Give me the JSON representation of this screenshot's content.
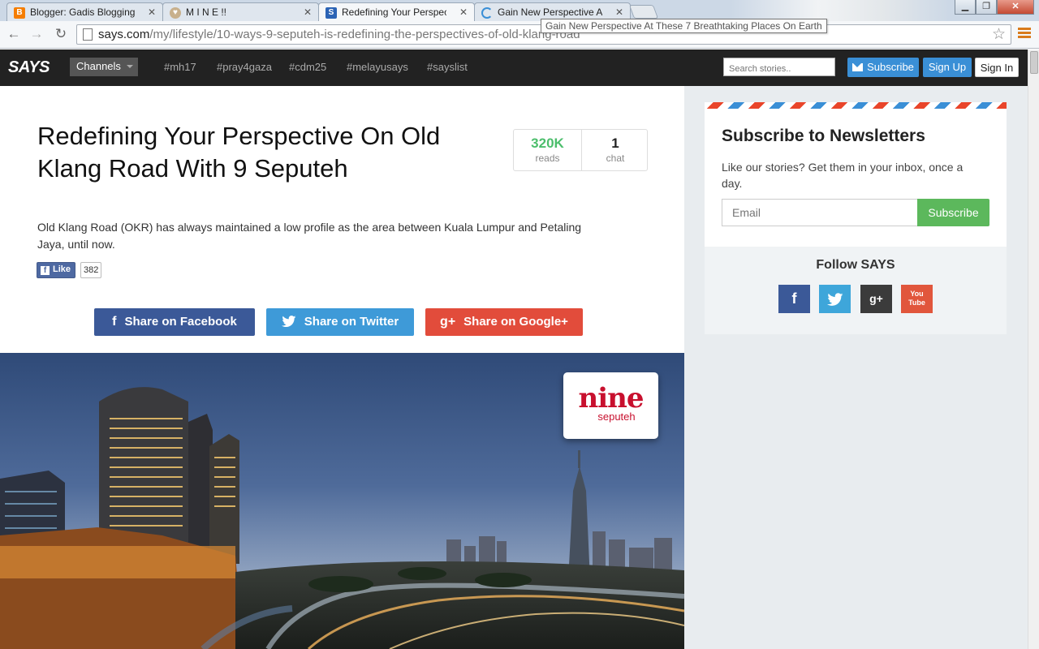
{
  "browser": {
    "tabs": [
      {
        "label": "Blogger: Gadis Blogging Ge",
        "favicon": "blogger-icon",
        "color": "#f57d00"
      },
      {
        "label": "M I N E !!",
        "favicon": "heart-icon",
        "color": "#c8b08c"
      },
      {
        "label": "Redefining Your Perspective",
        "favicon": "says-icon",
        "color": "#2b63b5"
      },
      {
        "label": "Gain New Perspective At T",
        "favicon": "loading-icon",
        "color": "#3a8fd6"
      }
    ],
    "url_host": "says.com",
    "url_path": "/my/lifestyle/10-ways-9-seputeh-is-redefining-the-perspectives-of-old-klang-road",
    "tooltip": "Gain New Perspective At These 7 Breathtaking Places On Earth"
  },
  "nav": {
    "logo": "SAYS",
    "channels": "Channels",
    "hashtags": [
      "#mh17",
      "#pray4gaza",
      "#cdm25",
      "#melayusays",
      "#sayslist"
    ],
    "search_placeholder": "Search stories..",
    "subscribe": "Subscribe",
    "signup": "Sign Up",
    "signin": "Sign In"
  },
  "article": {
    "title": "Redefining Your Perspective On Old Klang Road With 9 Seputeh",
    "reads_count": "320K",
    "reads_label": "reads",
    "chat_count": "1",
    "chat_label": "chat",
    "intro": "Old Klang Road (OKR) has always maintained a low profile as the area between Kuala Lumpur and Petaling Jaya, until now.",
    "like_label": "Like",
    "like_count": "382",
    "share_facebook": "Share on Facebook",
    "share_twitter": "Share on Twitter",
    "share_google": "Share on Google+",
    "hero_brand_big": "nine",
    "hero_brand_small": "seputeh"
  },
  "sidebar": {
    "newsletter_title": "Subscribe to Newsletters",
    "newsletter_desc": "Like our stories? Get them in your inbox, once a day.",
    "email_placeholder": "Email",
    "subscribe_button": "Subscribe",
    "follow_title": "Follow SAYS",
    "social": [
      "facebook-icon",
      "twitter-icon",
      "google-plus-icon",
      "youtube-icon"
    ],
    "youtube_label": "You Tube"
  }
}
